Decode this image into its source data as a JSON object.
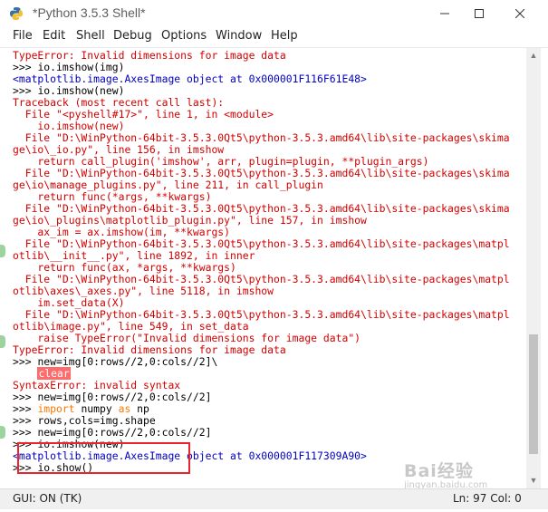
{
  "window": {
    "title": "*Python 3.5.3 Shell*",
    "icon": "python-icon"
  },
  "menu": [
    "File",
    "Edit",
    "Shell",
    "Debug",
    "Options",
    "Window",
    "Help"
  ],
  "shell": {
    "lines": [
      [
        {
          "t": "TypeError: Invalid dimensions for image data",
          "c": "err"
        }
      ],
      [
        {
          "t": ">>> ",
          "c": "prompt"
        },
        {
          "t": "io.imshow(img)",
          "c": "code"
        }
      ],
      [
        {
          "t": "<matplotlib.image.AxesImage object at 0x000001F116F61E48>",
          "c": "out"
        }
      ],
      [
        {
          "t": ">>> ",
          "c": "prompt"
        },
        {
          "t": "io.imshow(new)",
          "c": "code"
        }
      ],
      [
        {
          "t": "Traceback (most recent call last):",
          "c": "err"
        }
      ],
      [
        {
          "t": "  File \"<pyshell#17>\", line 1, in <module>",
          "c": "err"
        }
      ],
      [
        {
          "t": "    io.imshow(new)",
          "c": "err"
        }
      ],
      [
        {
          "t": "  File \"D:\\WinPython-64bit-3.5.3.0Qt5\\python-3.5.3.amd64\\lib\\site-packages\\skima",
          "c": "err"
        }
      ],
      [
        {
          "t": "ge\\io\\_io.py\", line 156, in imshow",
          "c": "err"
        }
      ],
      [
        {
          "t": "    return call_plugin('imshow', arr, plugin=plugin, **plugin_args)",
          "c": "err"
        }
      ],
      [
        {
          "t": "  File \"D:\\WinPython-64bit-3.5.3.0Qt5\\python-3.5.3.amd64\\lib\\site-packages\\skima",
          "c": "err"
        }
      ],
      [
        {
          "t": "ge\\io\\manage_plugins.py\", line 211, in call_plugin",
          "c": "err"
        }
      ],
      [
        {
          "t": "    return func(*args, **kwargs)",
          "c": "err"
        }
      ],
      [
        {
          "t": "  File \"D:\\WinPython-64bit-3.5.3.0Qt5\\python-3.5.3.amd64\\lib\\site-packages\\skima",
          "c": "err"
        }
      ],
      [
        {
          "t": "ge\\io\\_plugins\\matplotlib_plugin.py\", line 157, in imshow",
          "c": "err"
        }
      ],
      [
        {
          "t": "    ax_im = ax.imshow(im, **kwargs)",
          "c": "err"
        }
      ],
      [
        {
          "t": "  File \"D:\\WinPython-64bit-3.5.3.0Qt5\\python-3.5.3.amd64\\lib\\site-packages\\matpl",
          "c": "err"
        }
      ],
      [
        {
          "t": "otlib\\__init__.py\", line 1892, in inner",
          "c": "err"
        }
      ],
      [
        {
          "t": "    return func(ax, *args, **kwargs)",
          "c": "err"
        }
      ],
      [
        {
          "t": "  File \"D:\\WinPython-64bit-3.5.3.0Qt5\\python-3.5.3.amd64\\lib\\site-packages\\matpl",
          "c": "err"
        }
      ],
      [
        {
          "t": "otlib\\axes\\_axes.py\", line 5118, in imshow",
          "c": "err"
        }
      ],
      [
        {
          "t": "    im.set_data(X)",
          "c": "err"
        }
      ],
      [
        {
          "t": "  File \"D:\\WinPython-64bit-3.5.3.0Qt5\\python-3.5.3.amd64\\lib\\site-packages\\matpl",
          "c": "err"
        }
      ],
      [
        {
          "t": "otlib\\image.py\", line 549, in set_data",
          "c": "err"
        }
      ],
      [
        {
          "t": "    raise TypeError(\"Invalid dimensions for image data\")",
          "c": "err"
        }
      ],
      [
        {
          "t": "TypeError: Invalid dimensions for image data",
          "c": "err"
        }
      ],
      [
        {
          "t": ">>> ",
          "c": "prompt"
        },
        {
          "t": "new=img[0:rows//2,0:cols//2]\\",
          "c": "code"
        }
      ],
      [
        {
          "t": "    ",
          "c": "code"
        },
        {
          "t": "clear",
          "c": "hl"
        }
      ],
      [
        {
          "t": "SyntaxError: invalid syntax",
          "c": "err"
        }
      ],
      [
        {
          "t": ">>> ",
          "c": "prompt"
        },
        {
          "t": "new=img[0:rows//2,0:cols//2]",
          "c": "code"
        }
      ],
      [
        {
          "t": ">>> ",
          "c": "prompt"
        },
        {
          "t": "import",
          "c": "kw"
        },
        {
          "t": " numpy ",
          "c": "code"
        },
        {
          "t": "as",
          "c": "kw"
        },
        {
          "t": " np",
          "c": "code"
        }
      ],
      [
        {
          "t": ">>> ",
          "c": "prompt"
        },
        {
          "t": "rows,cols=img.shape",
          "c": "code"
        }
      ],
      [
        {
          "t": ">>> ",
          "c": "prompt"
        },
        {
          "t": "new=img[0:rows//2,0:cols//2]",
          "c": "code"
        }
      ],
      [
        {
          "t": ">>> ",
          "c": "prompt"
        },
        {
          "t": "io.imshow(new)",
          "c": "code"
        }
      ],
      [
        {
          "t": "<matplotlib.image.AxesImage object at 0x000001F117309A90>",
          "c": "out"
        }
      ],
      [
        {
          "t": ">>> ",
          "c": "prompt"
        },
        {
          "t": "io.show()",
          "c": "code"
        }
      ]
    ]
  },
  "status": {
    "left": "GUI: ON (TK)",
    "position": "Ln: 97  Col: 0"
  },
  "watermark": {
    "brand": "Bai",
    "suffix": "经验",
    "sub": "jingyan.baidu.com"
  },
  "colors": {
    "error": "#d30000",
    "output": "#0000c0",
    "keyword": "#ff7700",
    "highlight": "#ff6a6a",
    "annotation": "#e8242e"
  }
}
